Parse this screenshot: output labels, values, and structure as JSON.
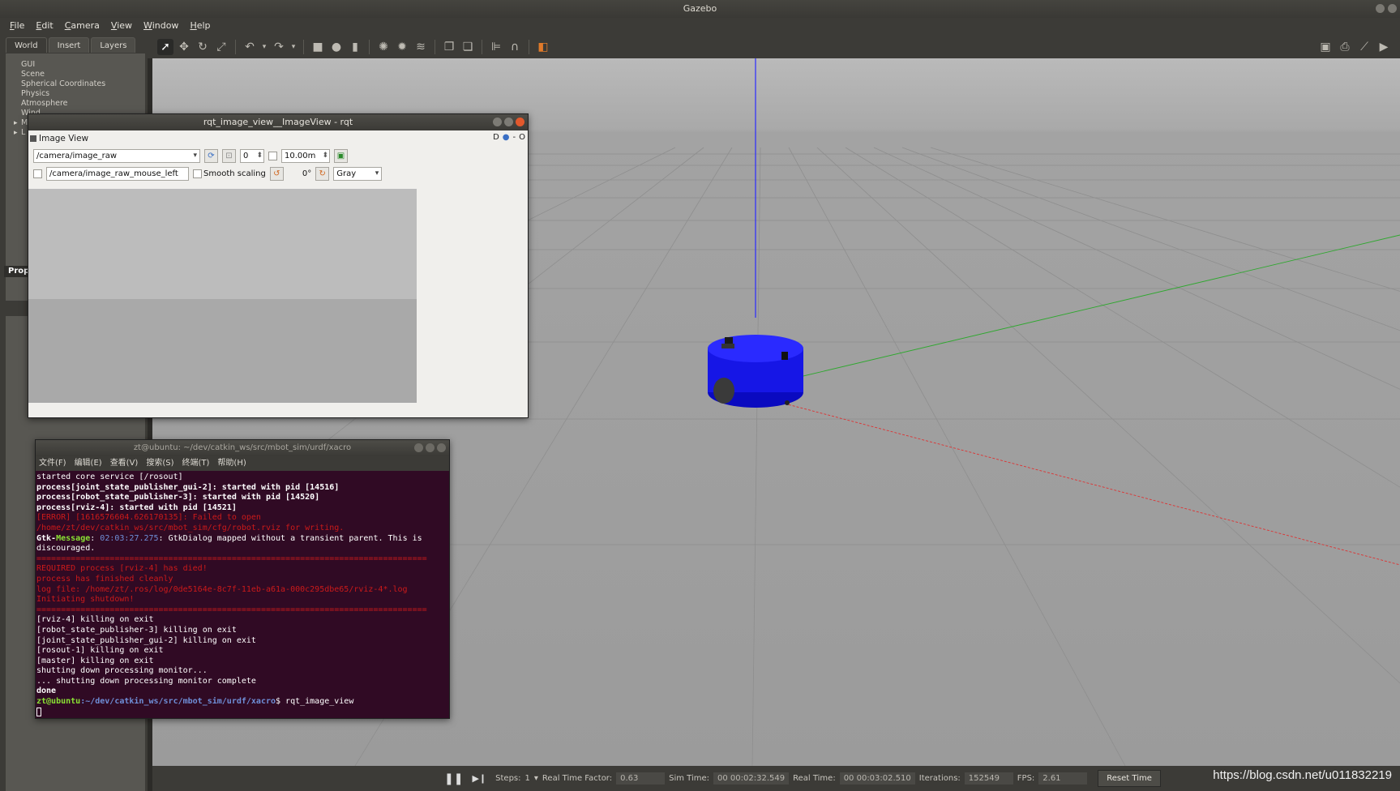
{
  "window": {
    "title": "Gazebo"
  },
  "menu": [
    "File",
    "Edit",
    "Camera",
    "View",
    "Window",
    "Help"
  ],
  "left_tabs": [
    "World",
    "Insert",
    "Layers"
  ],
  "world_tree": [
    "GUI",
    "Scene",
    "Spherical Coordinates",
    "Physics",
    "Atmosphere",
    "Wind",
    "M",
    "L"
  ],
  "property_label": "Prop",
  "status": {
    "steps_label": "Steps:",
    "steps_value": "1",
    "rtf_label": "Real Time Factor:",
    "rtf_value": "0.63",
    "sim_time_label": "Sim Time:",
    "sim_time_value": "00 00:02:32.549",
    "real_time_label": "Real Time:",
    "real_time_value": "00 00:03:02.510",
    "iterations_label": "Iterations:",
    "iterations_value": "152549",
    "fps_label": "FPS:",
    "fps_value": "2.61",
    "reset_time": "Reset Time"
  },
  "watermark": "https://blog.csdn.net/u011832219",
  "rqt": {
    "title": "rqt_image_view__ImageView - rqt",
    "dock_title": "Image View",
    "dock_right": "D",
    "dock_dash": "-",
    "dock_close": "O",
    "topic": "/camera/image_raw",
    "spin_value": "0",
    "period": "10.00m",
    "mouse_topic": "/camera/image_raw_mouse_left",
    "smooth_scaling": "Smooth scaling",
    "rotation": "0°",
    "color_scheme": "Gray"
  },
  "terminal": {
    "title": "zt@ubuntu: ~/dev/catkin_ws/src/mbot_sim/urdf/xacro",
    "menu": [
      "文件(F)",
      "编辑(E)",
      "查看(V)",
      "搜索(S)",
      "终端(T)",
      "帮助(H)"
    ],
    "lines": [
      {
        "text": "started core service [/rosout]",
        "style": ""
      },
      {
        "text": "process[joint_state_publisher_gui-2]: started with pid [14516]",
        "style": "b"
      },
      {
        "text": "process[robot_state_publisher-3]: started with pid [14520]",
        "style": "b"
      },
      {
        "text": "process[rviz-4]: started with pid [14521]",
        "style": "b"
      },
      {
        "text": "[ERROR] [1616576604.626170135]: Failed to open /home/zt/dev/catkin_ws/src/mbot_sim/cfg/robot.rviz for writing.",
        "style": "red"
      },
      {
        "text": "GTK_MSG",
        "style": "gtk"
      },
      {
        "text": "================================================================================",
        "style": "red"
      },
      {
        "text": "REQUIRED process [rviz-4] has died!",
        "style": "red"
      },
      {
        "text": "process has finished cleanly",
        "style": "red"
      },
      {
        "text": "log file: /home/zt/.ros/log/0de5164e-8c7f-11eb-a61a-000c295dbe65/rviz-4*.log",
        "style": "red"
      },
      {
        "text": "Initiating shutdown!",
        "style": "red"
      },
      {
        "text": "================================================================================",
        "style": "red"
      },
      {
        "text": "[rviz-4] killing on exit",
        "style": ""
      },
      {
        "text": "[robot_state_publisher-3] killing on exit",
        "style": ""
      },
      {
        "text": "[joint_state_publisher_gui-2] killing on exit",
        "style": ""
      },
      {
        "text": "[rosout-1] killing on exit",
        "style": ""
      },
      {
        "text": "[master] killing on exit",
        "style": ""
      },
      {
        "text": "shutting down processing monitor...",
        "style": ""
      },
      {
        "text": "... shutting down processing monitor complete",
        "style": ""
      },
      {
        "text": "done",
        "style": "b"
      }
    ],
    "gtk_prefix": "Gtk-",
    "gtk_message": "Message",
    "gtk_time": "02:03:27.275",
    "gtk_rest": ": GtkDialog mapped without a transient parent. This is discouraged.",
    "prompt_user": "zt@ubuntu",
    "prompt_path": ":~/dev/catkin_ws/src/mbot_sim/urdf/xacro",
    "prompt_cmd": "$ rqt_image_view"
  }
}
